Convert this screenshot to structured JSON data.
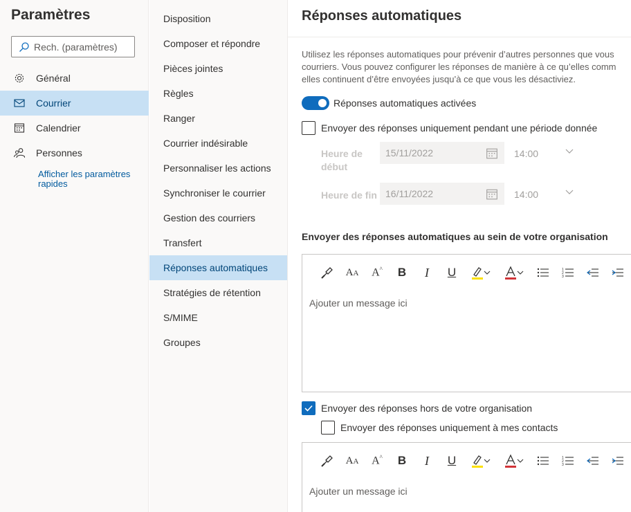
{
  "settings": {
    "title": "Paramètres",
    "search_placeholder": "Rech. (paramètres)",
    "nav": [
      {
        "label": "Général",
        "icon": "gear-icon"
      },
      {
        "label": "Courrier",
        "icon": "mail-icon",
        "active": true
      },
      {
        "label": "Calendrier",
        "icon": "calendar-icon"
      },
      {
        "label": "Personnes",
        "icon": "people-icon"
      }
    ],
    "quick_link": "Afficher les paramètres rapides"
  },
  "mail_menu": {
    "items": [
      "Disposition",
      "Composer et répondre",
      "Pièces jointes",
      "Règles",
      "Ranger",
      "Courrier indésirable",
      "Personnaliser les actions",
      "Synchroniser le courrier",
      "Gestion des courriers",
      "Transfert",
      "Réponses automatiques",
      "Stratégies de rétention",
      "S/MIME",
      "Groupes"
    ],
    "active_index": 10
  },
  "auto_replies": {
    "title": "Réponses automatiques",
    "description": "Utilisez les réponses automatiques pour prévenir d’autres personnes que vous courriers. Vous pouvez configurer les réponses de manière à ce qu’elles comm elles continuent d’être envoyées jusqu’à ce que vous les désactiviez.",
    "description_lines": [
      "Utilisez les réponses automatiques pour prévenir d’autres personnes que vous",
      "courriers. Vous pouvez configurer les réponses de manière à ce qu’elles comm",
      "elles continuent d’être envoyées jusqu’à ce que vous les désactiviez."
    ],
    "toggle_label": "Réponses automatiques activées",
    "toggle_on": true,
    "period_checkbox": "Envoyer des réponses uniquement pendant une période donnée",
    "period_checked": false,
    "start_label": "Heure de début",
    "start_date": "15/11/2022",
    "start_time": "14:00",
    "end_label": "Heure de fin",
    "end_date": "16/11/2022",
    "end_time": "14:00",
    "internal_title": "Envoyer des réponses automatiques au sein de votre organisation",
    "message_placeholder": "Ajouter un message ici",
    "external_checkbox": "Envoyer des réponses hors de votre organisation",
    "external_checked": true,
    "contacts_checkbox": "Envoyer des réponses uniquement à mes contacts",
    "contacts_checked": false,
    "toolbar": [
      "format-painter-icon",
      "font-size-icon",
      "grow-font-icon",
      "bold-icon",
      "italic-icon",
      "underline-icon",
      "highlight-icon",
      "font-color-icon",
      "bullets-icon",
      "numbering-icon",
      "decrease-indent-icon",
      "increase-indent-icon"
    ]
  },
  "colors": {
    "accent": "#0f6cbd",
    "selected_bg": "#c7e0f4",
    "highlight_bar": "#fce100",
    "font_color_bar": "#d13438"
  }
}
